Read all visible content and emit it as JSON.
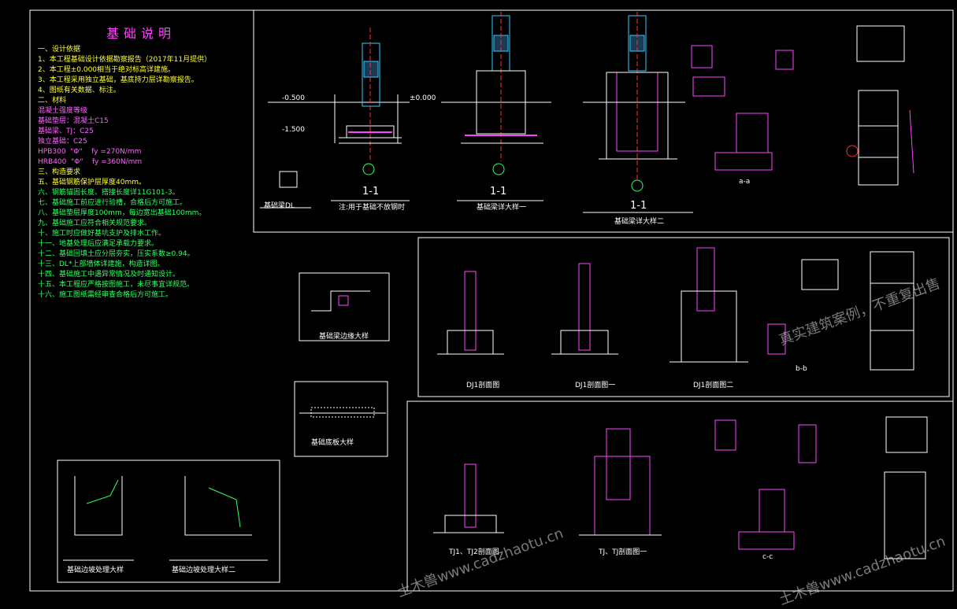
{
  "notes": {
    "title": "基础说明",
    "sec1": "一、设计依据",
    "items1": [
      "1、本工程基础设计依据勘察报告（2017年11月提供）",
      "2、本工程±0.000相当于绝对标高详建施。",
      "3、本工程采用独立基础，基底持力层详勘察报告。",
      "4、图纸有关数据、标注。"
    ],
    "sec2": "二、材料",
    "mat": [
      "混凝土强度等级",
      "基础垫层：混凝土C15",
      "基础梁、TJ：C25",
      "独立基础：C25"
    ],
    "rebar": [
      {
        "name": "HPB300",
        "sym": "\"Φ\"",
        "fy": "fy =270N/mm"
      },
      {
        "name": "HRB400",
        "sym": "\"Φ\"",
        "fy": "fy =360N/mm"
      }
    ],
    "sec3": "三、构造要求",
    "items3": [
      "五、基础钢筋保护层厚度40mm。",
      "六、钢筋锚固长度、搭接长度详11G101-3。",
      "七、基础施工前应进行验槽，合格后方可施工。",
      "八、基础垫层厚度100mm，每边宽出基础100mm。",
      "九、基础施工应符合相关规范要求。",
      "十、施工时应做好基坑支护及排水工作。",
      "十一、地基处理后应满足承载力要求。",
      "十二、基础回填土应分层夯实，压实系数≥0.94。",
      "十三、DL*上部墙体详建施，构造详图。",
      "十四、基础施工中遇异常情况及时通知设计。",
      "十五、本工程应严格按图施工，未尽事宜详规范。",
      "十六、施工图纸需经审查合格后方可施工。"
    ]
  },
  "labels": {
    "s11a": "1-1",
    "s11a_sub": "注:用于基础不放钢时",
    "s11b": "1-1",
    "s11b_sub": "基础梁详大样一",
    "s11c": "1-1",
    "s11c_sub": "基础梁详大样二",
    "dl": "基础梁DL",
    "aa": "a-a",
    "bb": "b-b",
    "cc": "c-c",
    "dj1": "DJ1剖面图",
    "dj1b": "DJ1剖面图一",
    "dj1c": "DJ1剖面图二",
    "tj": "TJ1、TJ2剖面图",
    "tj2": "TJ、TJ剖面图一",
    "bl1": "基础梁边缘大样",
    "bl2": "基础底板大样",
    "bl3": "基础边坡处理大样",
    "bl4": "基础边坡处理大样二",
    "elev1": "-0.500",
    "elev2": "-1.500",
    "elev3": "±0.000"
  },
  "watermarks": [
    "土木兽www.cadzhaotu.cn",
    "真实建筑案例，不重复出售"
  ],
  "colors": {
    "frame": "#ffffff",
    "dim": "#33ff66",
    "rebar": "#ff44ff",
    "cyan": "#33ccff",
    "red": "#ff3333",
    "yellow": "#ffff33"
  }
}
